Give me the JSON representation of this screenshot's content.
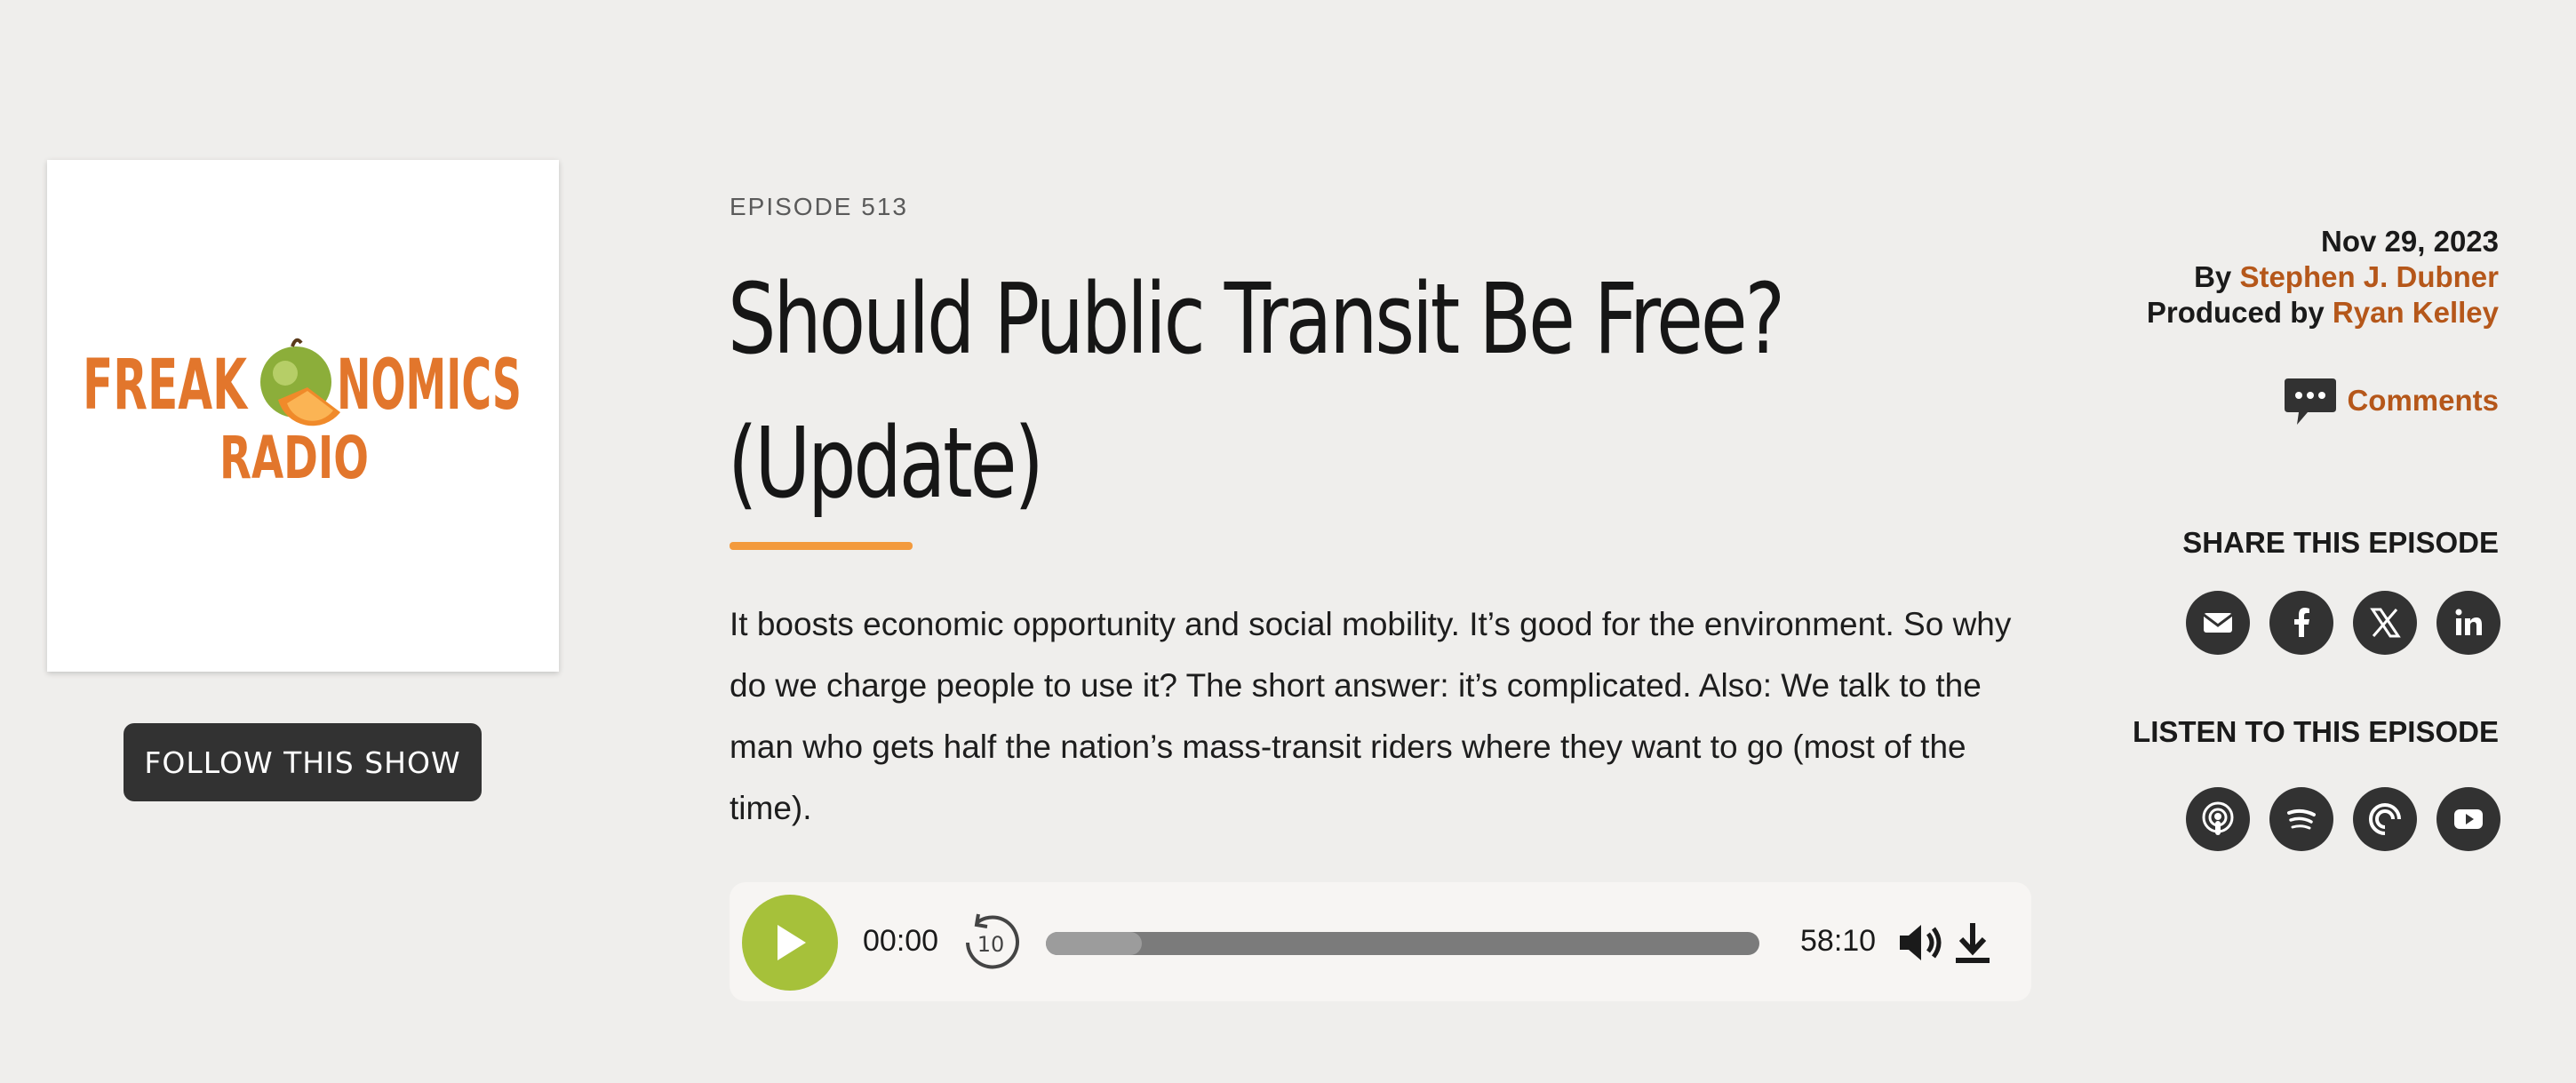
{
  "show": {
    "logo_line1_left": "FREAK",
    "logo_line1_right": "NOMICS",
    "logo_line2": "RADIO",
    "follow_label": "FOLLOW THIS SHOW"
  },
  "episode": {
    "label": "EPISODE 513",
    "title_line1": "Should Public Transit Be Free?",
    "title_line2": "(Update)",
    "description": "It boosts economic opportunity and social mobility. It’s good for the environment. So why do we charge people to use it? The short answer: it’s complicated. Also: We talk to the man who gets half the nation’s mass-transit riders where they want to go (most of the time)."
  },
  "player": {
    "current_time": "00:00",
    "total_time": "58:10",
    "rewind_seconds": "10",
    "progress_fraction": 0.135
  },
  "meta": {
    "date": "Nov 29, 2023",
    "by_label": "By",
    "author": "Stephen J. Dubner",
    "produced_label": "Produced by",
    "producer": "Ryan Kelley",
    "comments_label": "Comments"
  },
  "share": {
    "heading": "SHARE THIS EPISODE",
    "icons": [
      "email-icon",
      "facebook-icon",
      "x-icon",
      "linkedin-icon"
    ]
  },
  "listen": {
    "heading": "LISTEN TO THIS EPISODE",
    "icons": [
      "apple-podcasts-icon",
      "spotify-icon",
      "pocket-casts-icon",
      "youtube-icon"
    ]
  },
  "colors": {
    "background": "#efeeec",
    "accent_orange": "#f39a3d",
    "link_brown": "#b5571a",
    "play_green": "#a6c13a",
    "dark": "#323232"
  }
}
